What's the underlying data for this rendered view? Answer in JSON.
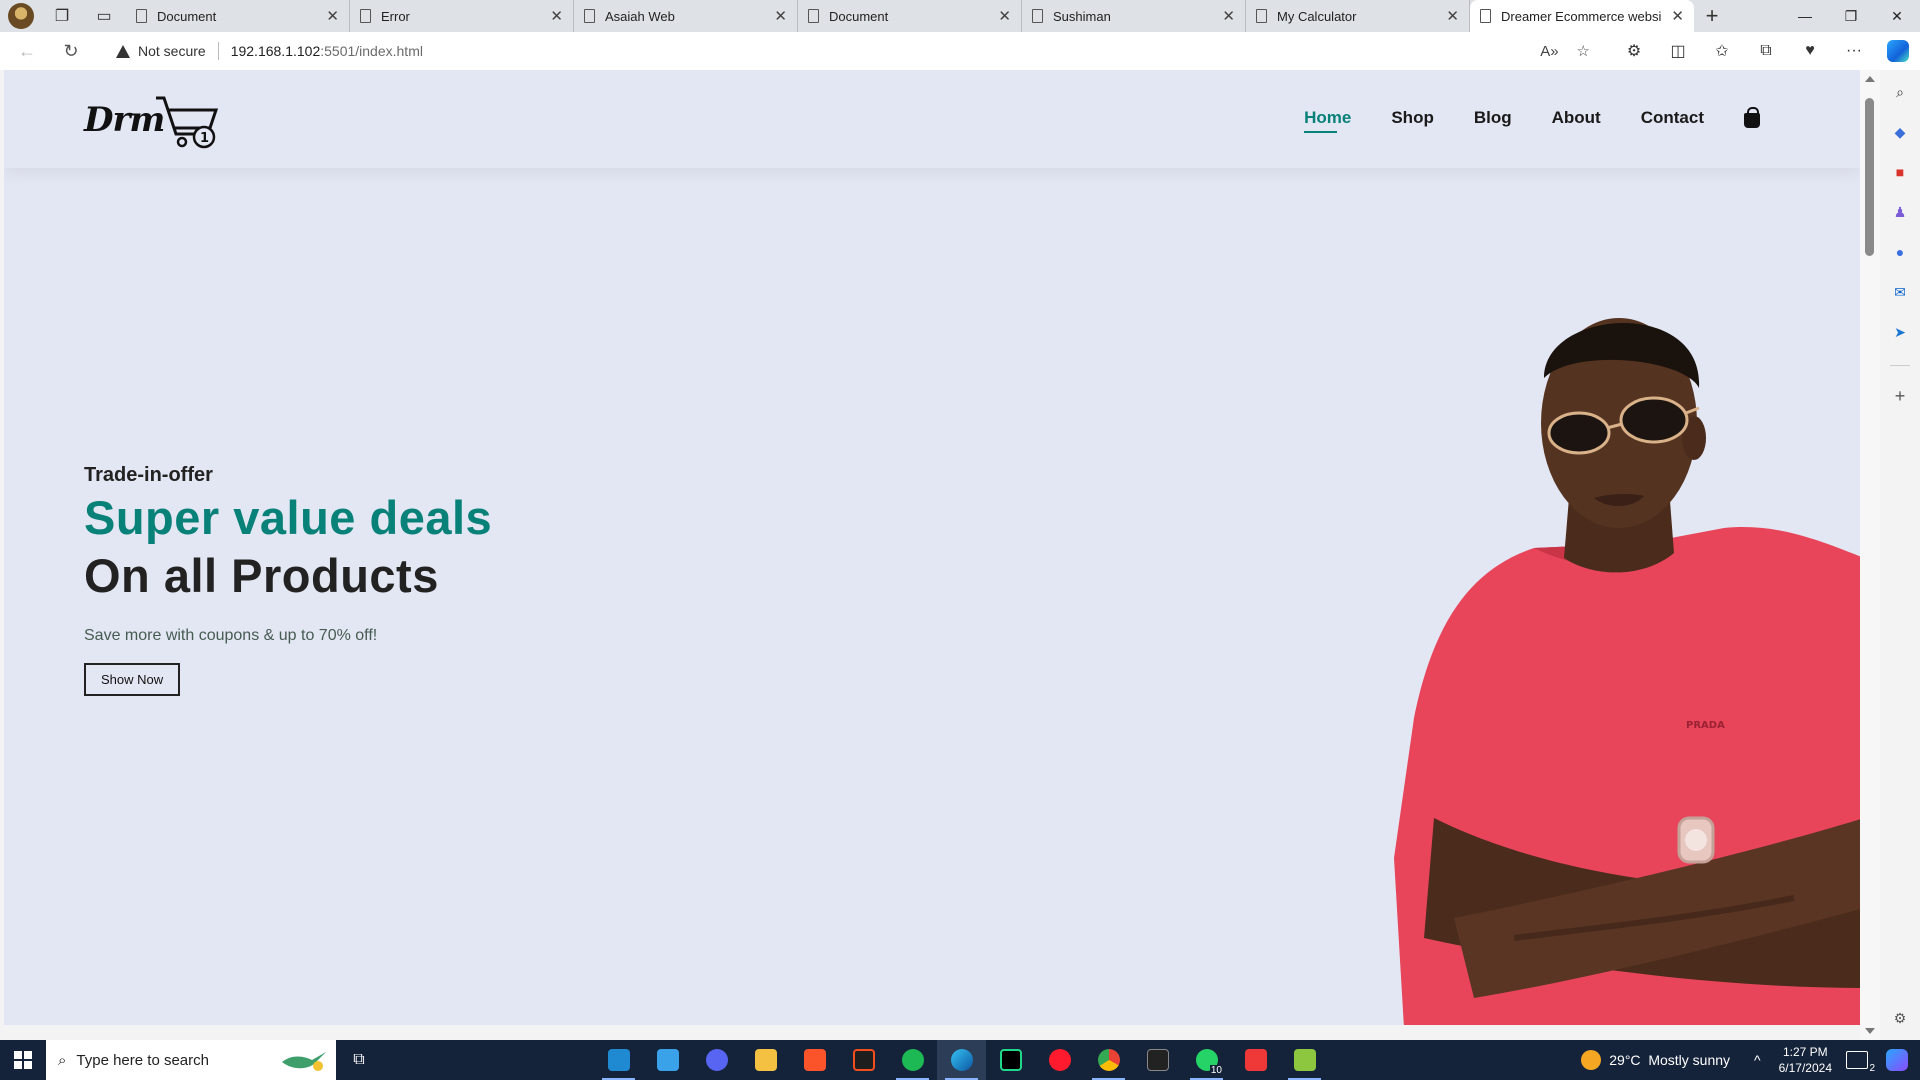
{
  "browser": {
    "tabs": [
      {
        "label": "Document",
        "active": false
      },
      {
        "label": "Error",
        "active": false
      },
      {
        "label": "Asaiah Web",
        "active": false
      },
      {
        "label": "Document",
        "active": false
      },
      {
        "label": "Sushiman",
        "active": false
      },
      {
        "label": "My Calculator",
        "active": false
      },
      {
        "label": "Dreamer Ecommerce website",
        "active": true
      }
    ],
    "security_label": "Not secure",
    "url_host": "192.168.1.102",
    "url_rest": ":5501/index.html"
  },
  "site": {
    "logo_text": "Drm",
    "cart_count": "1",
    "nav": [
      {
        "label": "Home",
        "active": true
      },
      {
        "label": "Shop",
        "active": false
      },
      {
        "label": "Blog",
        "active": false
      },
      {
        "label": "About",
        "active": false
      },
      {
        "label": "Contact",
        "active": false
      }
    ],
    "hero": {
      "kicker": "Trade-in-offer",
      "headline": "Super value deals",
      "subhead": "On all Products",
      "promo": "Save more with coupons & up to 70% off!",
      "button_label": "Show Now",
      "shirt_text": "PRADA"
    }
  },
  "taskbar": {
    "search_placeholder": "Type here to search",
    "weather": "29°C  Mostly sunny",
    "time": "1:27 PM",
    "date": "6/17/2024",
    "whatsapp_badge": "10",
    "notification_count": "2"
  },
  "colors": {
    "brand": "#088178",
    "page_bg": "#e3e6f3",
    "taskbar": "#15233a"
  }
}
